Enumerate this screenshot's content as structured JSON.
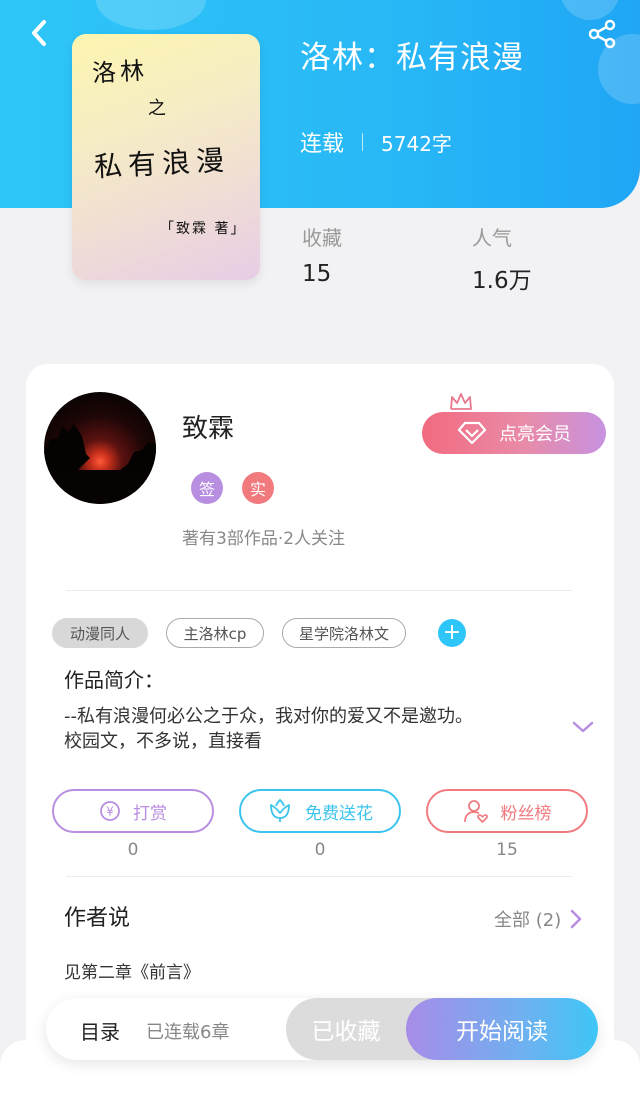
{
  "colors": {
    "header": "#2ec6f8",
    "accent_blue": "#2ec6f8",
    "purple": "#b88ee0",
    "salmon": "#f07a7e",
    "cyan": "#3cc4ec",
    "text_dark": "#222222",
    "text_gray": "#888888"
  },
  "header": {
    "back_icon": "chevron-left-icon",
    "share_icon": "share-icon"
  },
  "book": {
    "cover": {
      "line1": "洛林",
      "line2": "之",
      "line3": "私有浪漫",
      "author": "「致霖 著」"
    },
    "title": "洛林：私有浪漫",
    "status": "连载",
    "word_count": "5742字",
    "stats": [
      {
        "label": "收藏",
        "value": "15"
      },
      {
        "label": "人气",
        "value": "1.6万"
      }
    ]
  },
  "author": {
    "name": "致霖",
    "badges": [
      {
        "text": "签",
        "color": "#b88ee0"
      },
      {
        "text": "实",
        "color": "#f07a7e"
      }
    ],
    "stats_text": "著有3部作品·2人关注",
    "vip_button": "点亮会员"
  },
  "tags": [
    {
      "label": "动漫同人",
      "style": "filled"
    },
    {
      "label": "主洛林cp",
      "style": "outline"
    },
    {
      "label": "星学院洛林文",
      "style": "outline"
    }
  ],
  "add_tag_icon": "plus-icon",
  "intro": {
    "title": "作品简介：",
    "line1": "--私有浪漫何必公之于众，我对你的爱又不是邀功。",
    "line2": "校园文，不多说，直接看"
  },
  "actions": [
    {
      "label": "打赏",
      "icon": "yen-coin-icon",
      "count": "0",
      "color": "#b88ee0"
    },
    {
      "label": "免费送花",
      "icon": "flower-icon",
      "count": "0",
      "color": "#3cc4ec"
    },
    {
      "label": "粉丝榜",
      "icon": "user-heart-icon",
      "count": "15",
      "color": "#f07a7e"
    }
  ],
  "author_says": {
    "title": "作者说",
    "all_label": "全部 (2)",
    "text": "见第二章《前言》"
  },
  "bottom_bar": {
    "toc_label": "目录",
    "toc_count": "已连载6章",
    "collected_label": "已收藏",
    "read_label": "开始阅读"
  }
}
